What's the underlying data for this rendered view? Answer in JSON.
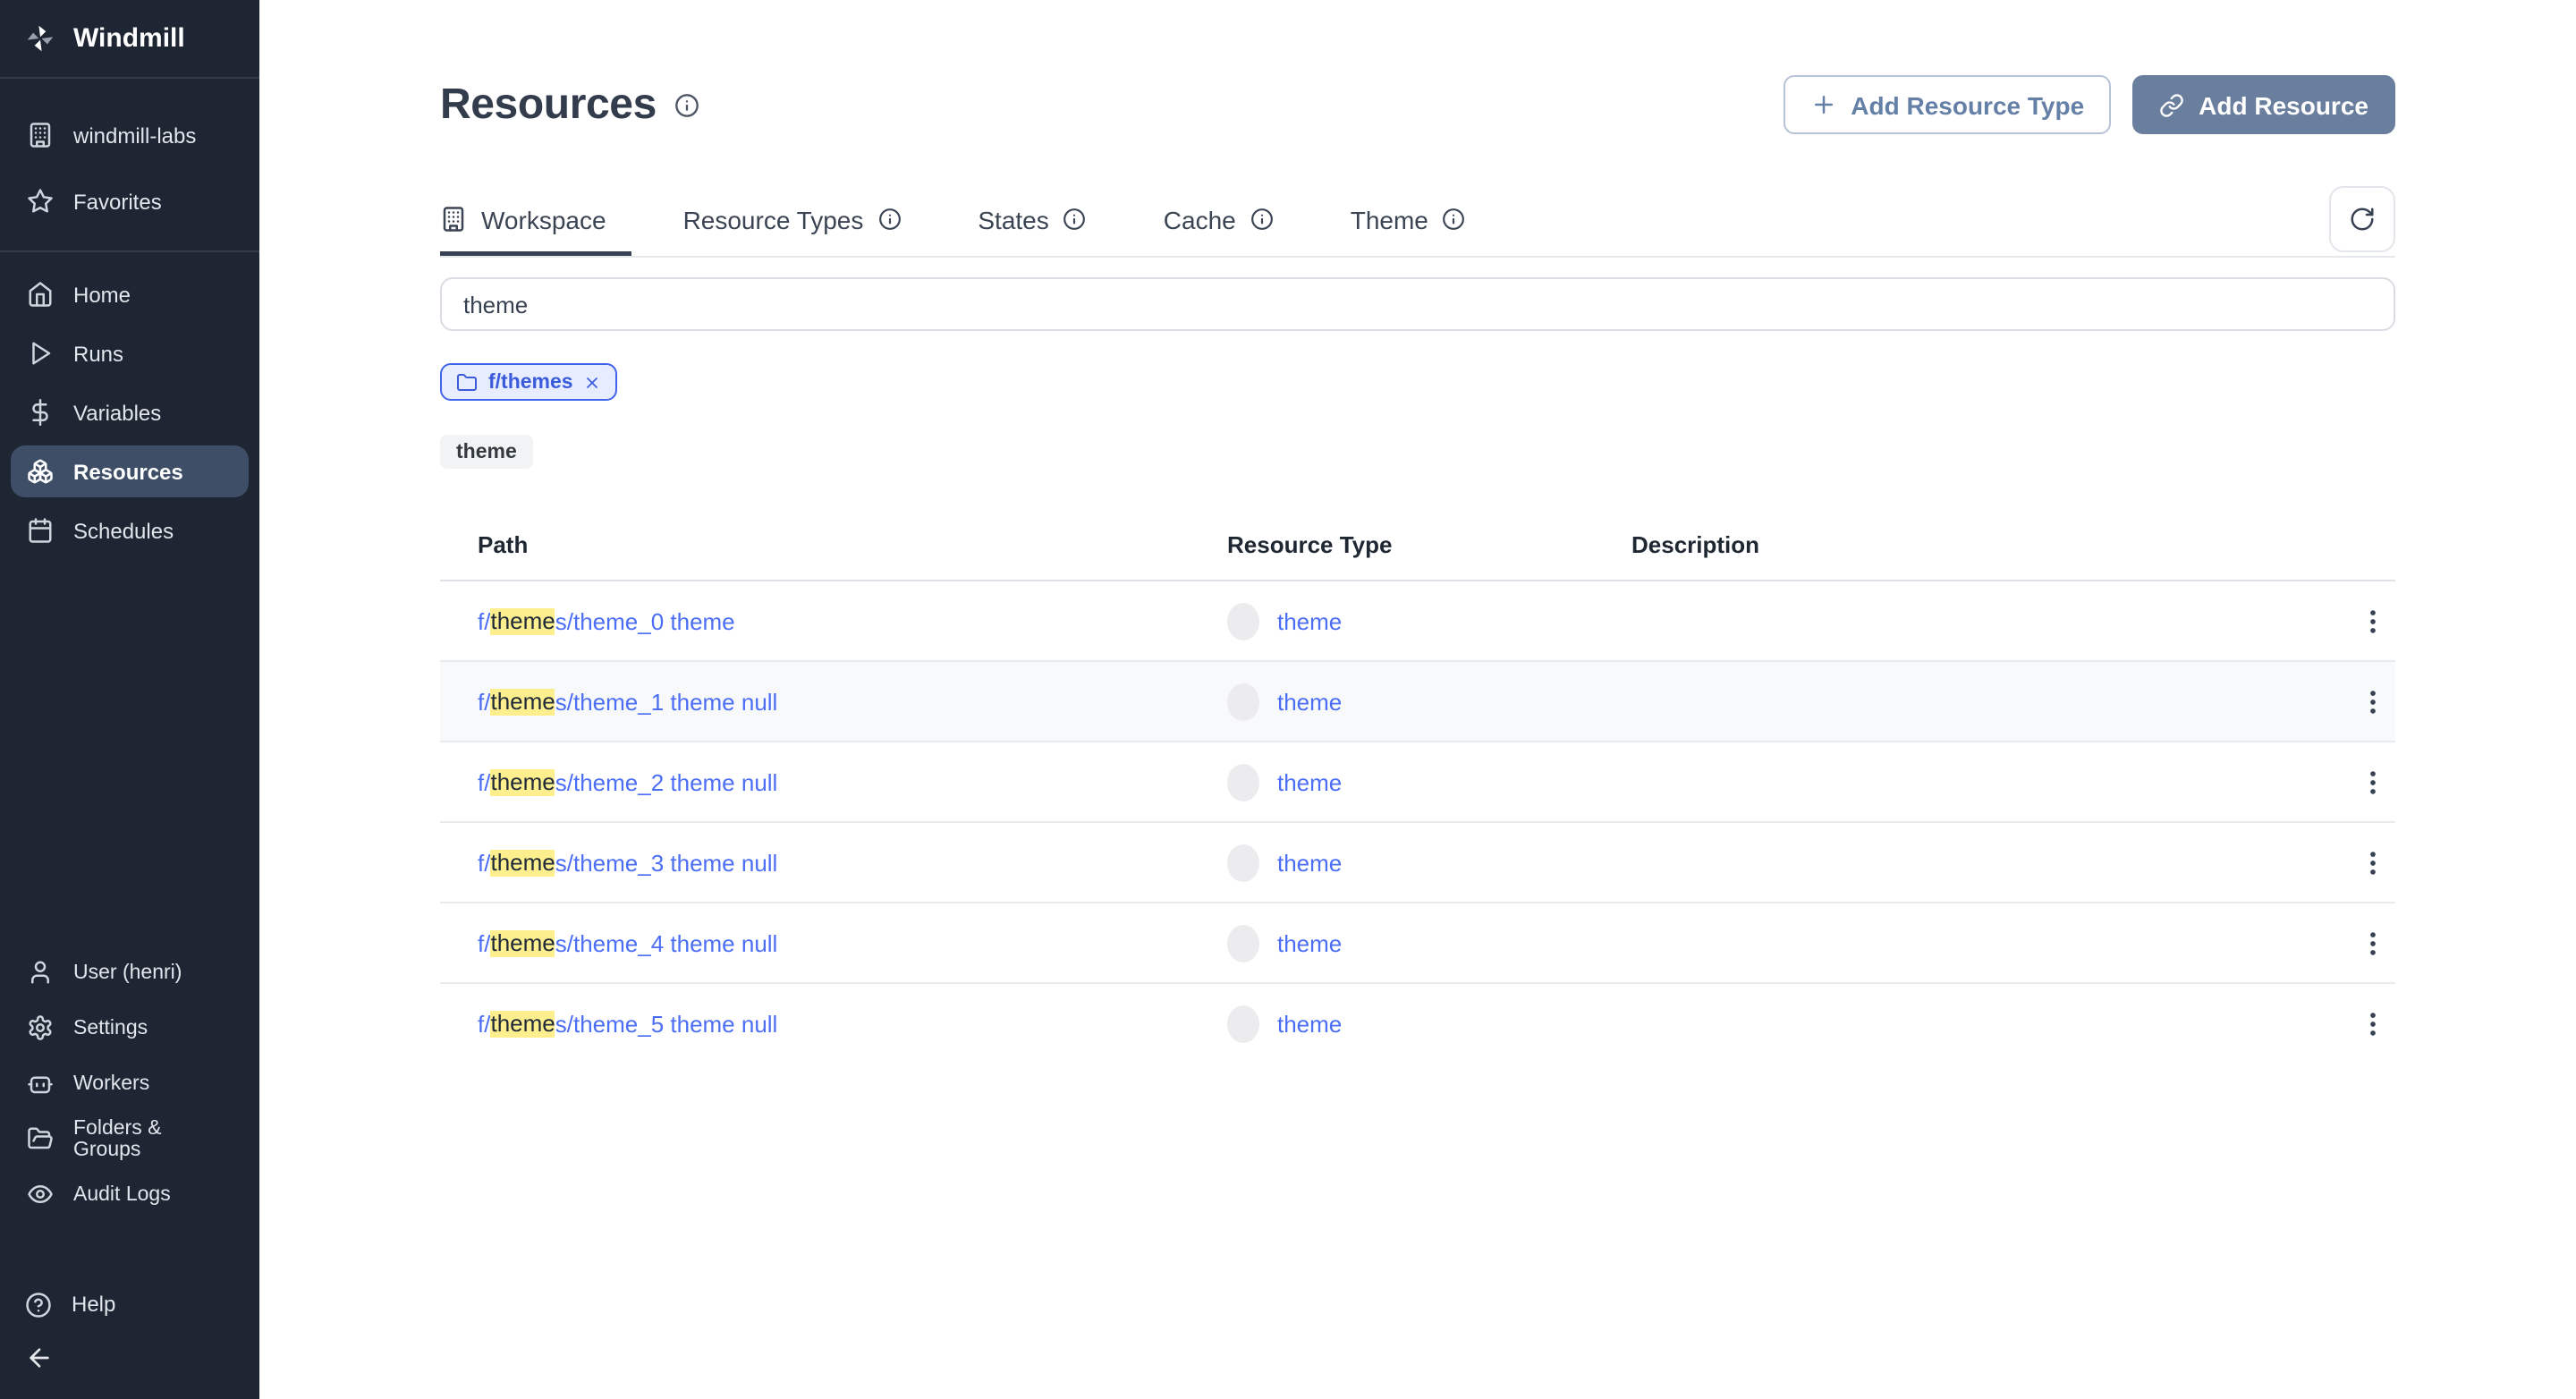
{
  "app": {
    "name": "Windmill"
  },
  "sidebar": {
    "top_items": [
      {
        "label": "windmill-labs",
        "icon": "building-icon"
      },
      {
        "label": "Favorites",
        "icon": "star-icon"
      }
    ],
    "nav_items": [
      {
        "label": "Home",
        "icon": "home-icon"
      },
      {
        "label": "Runs",
        "icon": "play-icon"
      },
      {
        "label": "Variables",
        "icon": "dollar-icon"
      },
      {
        "label": "Resources",
        "icon": "boxes-icon",
        "active": true
      },
      {
        "label": "Schedules",
        "icon": "calendar-icon"
      }
    ],
    "secondary_items": [
      {
        "label": "User (henri)",
        "icon": "user-icon"
      },
      {
        "label": "Settings",
        "icon": "gear-icon"
      },
      {
        "label": "Workers",
        "icon": "robot-icon"
      },
      {
        "label": "Folders & Groups",
        "icon": "folder-open-icon"
      },
      {
        "label": "Audit Logs",
        "icon": "eye-icon"
      }
    ],
    "help_label": "Help"
  },
  "header": {
    "title": "Resources",
    "actions": {
      "add_resource_type": "Add Resource Type",
      "add_resource": "Add Resource"
    }
  },
  "tabs": [
    {
      "label": "Workspace",
      "icon": "building-icon",
      "active": true
    },
    {
      "label": "Resource Types",
      "has_info": true
    },
    {
      "label": "States",
      "has_info": true
    },
    {
      "label": "Cache",
      "has_info": true
    },
    {
      "label": "Theme",
      "has_info": true
    }
  ],
  "filters": {
    "search_value": "theme",
    "folder_chip_label": "f/themes",
    "keyword_chip_label": "theme"
  },
  "table": {
    "columns": [
      "Path",
      "Resource Type",
      "Description"
    ],
    "rows": [
      {
        "path_prefix": "f/",
        "path_match": "theme",
        "path_suffix": "s/theme_0 theme",
        "resource_type": "theme",
        "description": ""
      },
      {
        "path_prefix": "f/",
        "path_match": "theme",
        "path_suffix": "s/theme_1 theme null",
        "resource_type": "theme",
        "description": "",
        "shaded": true
      },
      {
        "path_prefix": "f/",
        "path_match": "theme",
        "path_suffix": "s/theme_2 theme null",
        "resource_type": "theme",
        "description": ""
      },
      {
        "path_prefix": "f/",
        "path_match": "theme",
        "path_suffix": "s/theme_3 theme null",
        "resource_type": "theme",
        "description": ""
      },
      {
        "path_prefix": "f/",
        "path_match": "theme",
        "path_suffix": "s/theme_4 theme null",
        "resource_type": "theme",
        "description": ""
      },
      {
        "path_prefix": "f/",
        "path_match": "theme",
        "path_suffix": "s/theme_5 theme null",
        "resource_type": "theme",
        "description": ""
      }
    ]
  },
  "colors": {
    "sidebar_bg": "#1f2633",
    "sidebar_active_bg": "#3e4e66",
    "primary_button_bg": "#6a7e9e",
    "secondary_button_text": "#6580a6",
    "link_blue": "#4c6ef5",
    "highlight_yellow": "#fdef8d",
    "folder_chip_border": "#4263eb",
    "folder_chip_bg": "#e7edff",
    "folder_chip_text": "#3b5bdb",
    "keyword_chip_bg": "#f1f3f5",
    "row_shaded_bg": "#f8f9fa",
    "tab_underline": "#374151"
  }
}
